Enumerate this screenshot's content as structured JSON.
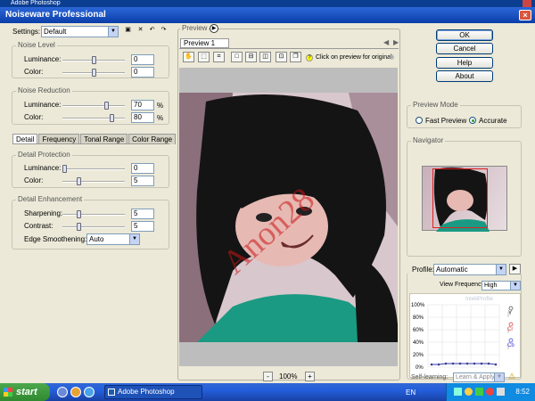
{
  "outer_title": "Adobe Photoshop",
  "window": {
    "title": "Noiseware Professional",
    "close": "×"
  },
  "settings": {
    "label": "Settings:",
    "value": "Default"
  },
  "noise_level": {
    "title": "Noise Level",
    "luminance_label": "Luminance:",
    "luminance": "0",
    "color_label": "Color:",
    "color": "0"
  },
  "noise_reduction": {
    "title": "Noise Reduction",
    "luminance_label": "Luminance:",
    "luminance": "70",
    "color_label": "Color:",
    "color": "80",
    "unit": "%"
  },
  "tabs": [
    "Detail",
    "Frequency",
    "Tonal Range",
    "Color Range"
  ],
  "detail_protection": {
    "title": "Detail Protection",
    "luminance_label": "Luminance:",
    "luminance": "0",
    "color_label": "Color:",
    "color": "5"
  },
  "detail_enhancement": {
    "title": "Detail Enhancement",
    "sharpening_label": "Sharpening:",
    "sharpening": "5",
    "contrast_label": "Contrast:",
    "contrast": "5",
    "edge_label": "Edge Smoothening:",
    "edge_value": "Auto"
  },
  "preview": {
    "title": "Preview",
    "tab": "Preview 1",
    "hint": "Click on preview for original",
    "zoom": "100%",
    "minus": "-",
    "plus": "+"
  },
  "buttons": {
    "ok": "OK",
    "cancel": "Cancel",
    "help": "Help",
    "about": "About"
  },
  "preview_mode": {
    "title": "Preview Mode",
    "fast": "Fast Preview",
    "accurate": "Accurate",
    "selected": "accurate"
  },
  "navigator": {
    "title": "Navigator"
  },
  "profile": {
    "label": "Profile:",
    "value": "Automatic",
    "view_freq_label": "View Frequency:",
    "view_freq": "High",
    "graph_title": "IntelliProfile",
    "y_ticks": [
      "100%",
      "80%",
      "60%",
      "40%",
      "20%",
      "0%"
    ],
    "legend": [
      "Y",
      "Cr",
      "Cb"
    ],
    "self_learning_label": "Self-learning:",
    "self_learning_value": "Learn & Apply"
  },
  "taskbar": {
    "start": "start",
    "task": "Adobe Photoshop",
    "lang": "EN",
    "time": "8:52"
  },
  "watermark": "Anon28"
}
